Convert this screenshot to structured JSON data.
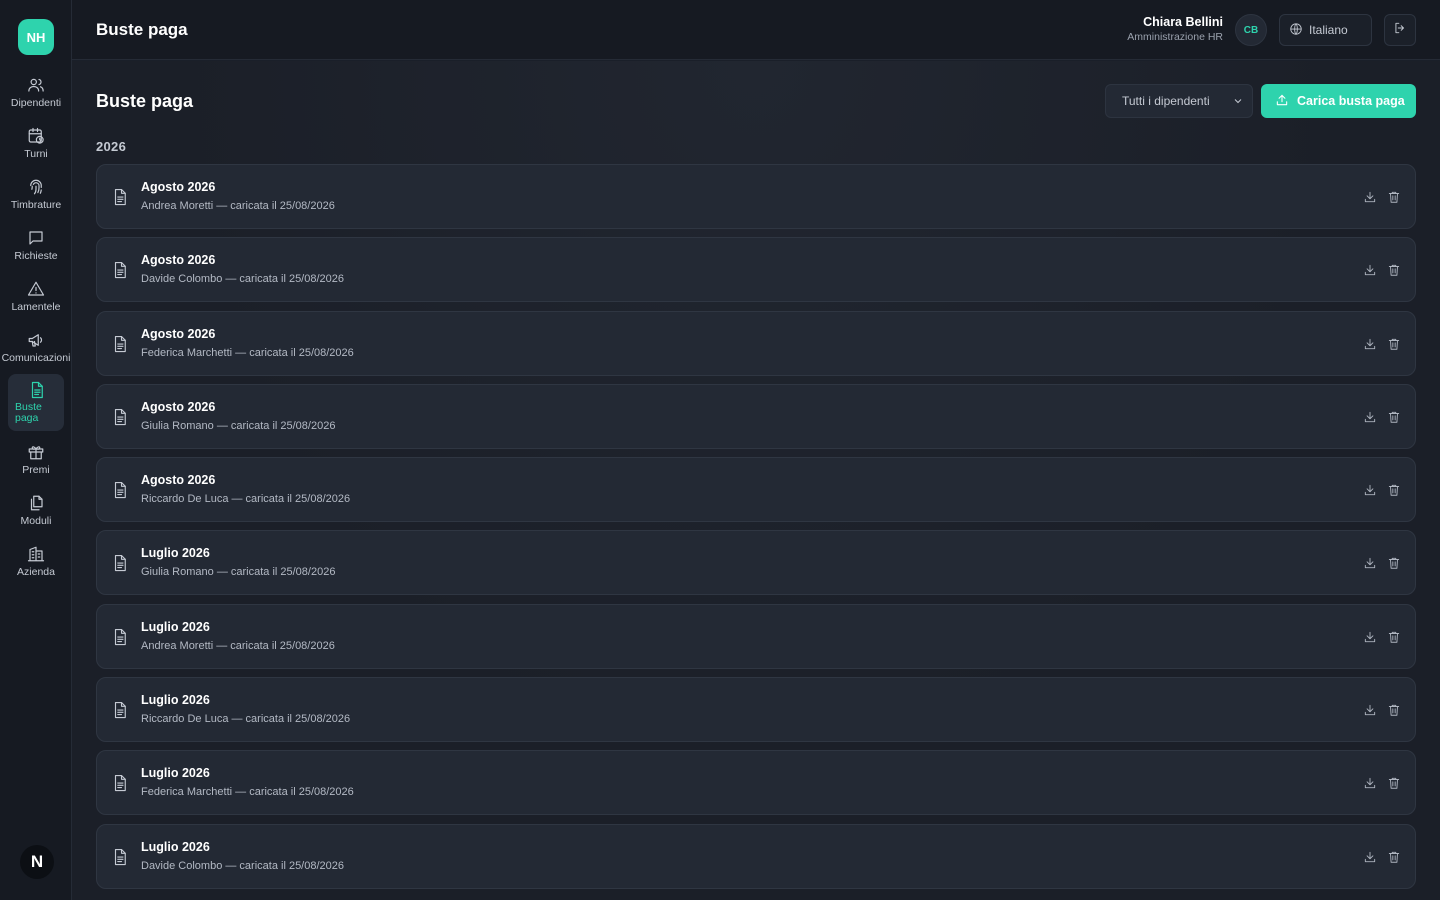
{
  "app": {
    "logo_text": "NH",
    "bottom_badge": "N"
  },
  "sidebar": {
    "items": [
      {
        "label": "Dipendenti",
        "icon": "users-icon"
      },
      {
        "label": "Turni",
        "icon": "calendar-clock-icon"
      },
      {
        "label": "Timbrature",
        "icon": "fingerprint-icon"
      },
      {
        "label": "Richieste",
        "icon": "message-square-icon"
      },
      {
        "label": "Lamentele",
        "icon": "alert-triangle-icon"
      },
      {
        "label": "Comunicazioni",
        "icon": "megaphone-icon"
      },
      {
        "label": "Buste paga",
        "icon": "file-text-icon",
        "active": true
      },
      {
        "label": "Premi",
        "icon": "gift-icon"
      },
      {
        "label": "Moduli",
        "icon": "files-icon"
      },
      {
        "label": "Azienda",
        "icon": "building-icon"
      }
    ]
  },
  "header": {
    "title": "Buste paga",
    "user_name": "Chiara Bellini",
    "user_role": "Amministrazione HR",
    "avatar_initials": "CB",
    "language": "Italiano"
  },
  "main": {
    "title": "Buste paga",
    "filter_value": "Tutti i dipendenti",
    "upload_label": "Carica busta paga",
    "year": "2026",
    "payslips": [
      {
        "month": "Agosto 2026",
        "meta": "Andrea Moretti — caricata il 25/08/2026"
      },
      {
        "month": "Agosto 2026",
        "meta": "Davide Colombo — caricata il 25/08/2026"
      },
      {
        "month": "Agosto 2026",
        "meta": "Federica Marchetti — caricata il 25/08/2026"
      },
      {
        "month": "Agosto 2026",
        "meta": "Giulia Romano — caricata il 25/08/2026"
      },
      {
        "month": "Agosto 2026",
        "meta": "Riccardo De Luca — caricata il 25/08/2026"
      },
      {
        "month": "Luglio 2026",
        "meta": "Giulia Romano — caricata il 25/08/2026"
      },
      {
        "month": "Luglio 2026",
        "meta": "Andrea Moretti — caricata il 25/08/2026"
      },
      {
        "month": "Luglio 2026",
        "meta": "Riccardo De Luca — caricata il 25/08/2026"
      },
      {
        "month": "Luglio 2026",
        "meta": "Federica Marchetti — caricata il 25/08/2026"
      },
      {
        "month": "Luglio 2026",
        "meta": "Davide Colombo — caricata il 25/08/2026"
      }
    ]
  },
  "colors": {
    "accent": "#2ed3ad",
    "background": "#1a1f29",
    "card": "#232934"
  }
}
